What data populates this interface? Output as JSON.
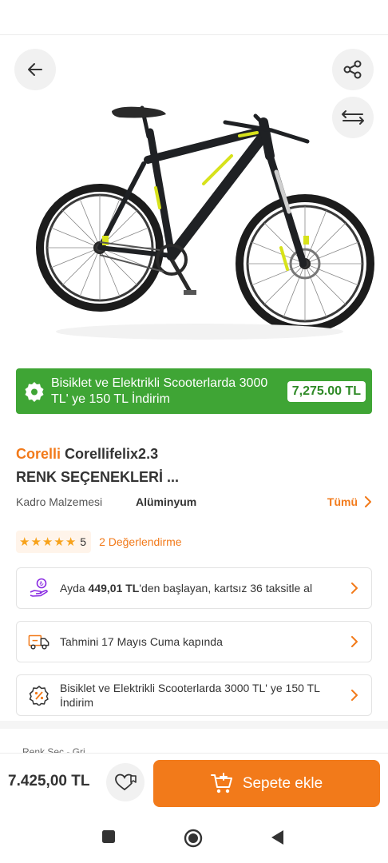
{
  "colors": {
    "accent": "#f27a1a",
    "promo_green": "#3fa535",
    "star": "#f7a21b"
  },
  "header": {
    "back_icon": "arrow-left-icon",
    "share_icon": "share-icon",
    "compare_icon": "compare-arrows-icon"
  },
  "promo": {
    "text": "Bisiklet ve Elektrikli Scooterlarda 3000 TL' ye 150 TL İndirim",
    "price": "7,275.00 TL",
    "icon": "discount-badge-icon"
  },
  "product": {
    "brand": "Corelli",
    "name": "Corellifelix2.3",
    "name_line2": "RENK SEÇENEKLERİ ..."
  },
  "spec": {
    "key": "Kadro Malzemesi",
    "value": "Alüminyum",
    "all_label": "Tümü"
  },
  "rating": {
    "stars": 5,
    "score": "5",
    "reviews_label": "2 Değerlendirme"
  },
  "cards": [
    {
      "icon": "installment-coin-icon",
      "pre": "Ayda ",
      "bold": "449,01 TL",
      "post": "'den başlayan, kartsız 36 taksitle al"
    },
    {
      "icon": "delivery-truck-icon",
      "text": "Tahmini 17 Mayıs Cuma kapında"
    },
    {
      "icon": "discount-tag-icon",
      "text": "Bisiklet ve Elektrikli Scooterlarda 3000 TL' ye 150 TL İndirim"
    }
  ],
  "peek_text": "Renk Seç - Gri",
  "bottom": {
    "price": "7.425,00 TL",
    "cart_label": "Sepete ekle",
    "fav_icon": "heart-icon"
  },
  "nav": {
    "recent": "square-icon",
    "home": "circle-icon",
    "back": "triangle-back-icon"
  }
}
